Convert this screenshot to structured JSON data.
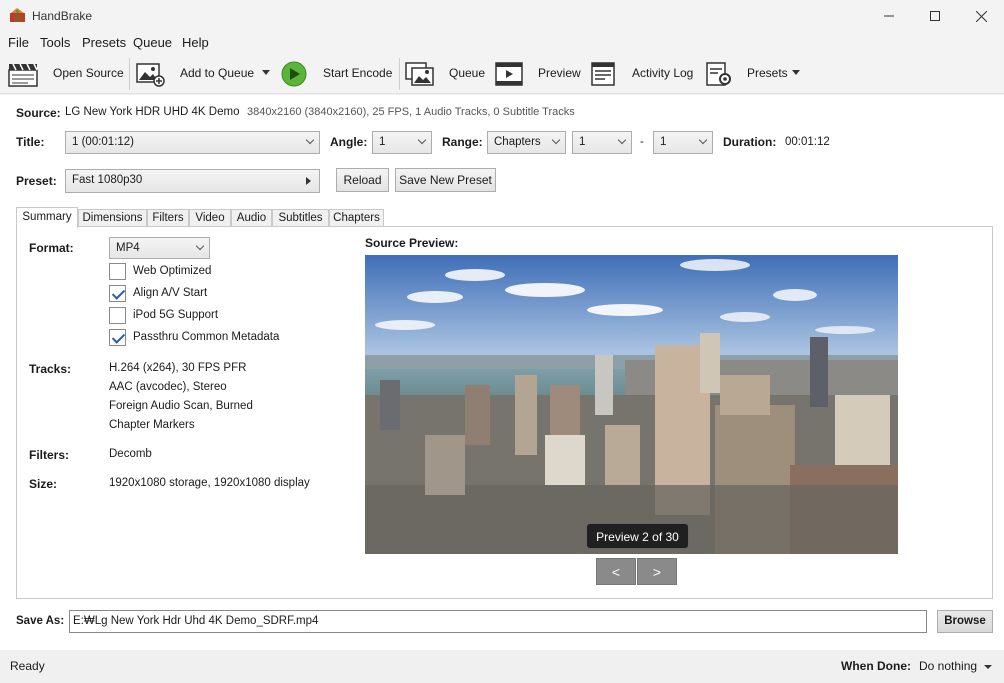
{
  "window": {
    "title": "HandBrake"
  },
  "menu": [
    "File",
    "Tools",
    "Presets",
    "Queue",
    "Help"
  ],
  "toolbar": {
    "open_source": "Open Source",
    "add_to_queue": "Add to Queue",
    "start_encode": "Start Encode",
    "queue": "Queue",
    "preview": "Preview",
    "activity_log": "Activity Log",
    "presets": "Presets"
  },
  "source": {
    "label": "Source:",
    "name": "LG New York HDR UHD 4K Demo",
    "details": "3840x2160 (3840x2160), 25 FPS, 1 Audio Tracks, 0 Subtitle Tracks"
  },
  "title_row": {
    "title_label": "Title:",
    "title_value": "1  (00:01:12)",
    "angle_label": "Angle:",
    "angle_value": "1",
    "range_label": "Range:",
    "range_mode": "Chapters",
    "range_start": "1",
    "range_dash": "-",
    "range_end": "1",
    "duration_label": "Duration:",
    "duration_value": "00:01:12"
  },
  "preset_row": {
    "label": "Preset:",
    "value": "Fast 1080p30",
    "reload": "Reload",
    "save_new": "Save New Preset"
  },
  "tabs": [
    "Summary",
    "Dimensions",
    "Filters",
    "Video",
    "Audio",
    "Subtitles",
    "Chapters"
  ],
  "summary": {
    "format_label": "Format:",
    "format_value": "MP4",
    "options": [
      {
        "label": "Web Optimized",
        "checked": false
      },
      {
        "label": "Align A/V Start",
        "checked": true
      },
      {
        "label": "iPod 5G Support",
        "checked": false
      },
      {
        "label": "Passthru Common Metadata",
        "checked": true
      }
    ],
    "tracks_label": "Tracks:",
    "tracks": [
      "H.264 (x264), 30 FPS PFR",
      "AAC (avcodec), Stereo",
      "Foreign Audio Scan, Burned",
      "Chapter Markers"
    ],
    "filters_label": "Filters:",
    "filters_value": "Decomb",
    "size_label": "Size:",
    "size_value": "1920x1080 storage, 1920x1080 display",
    "preview_label": "Source Preview:",
    "preview_badge": "Preview 2 of 30",
    "prev_btn": "<",
    "next_btn": ">"
  },
  "save_as": {
    "label": "Save As:",
    "value": "E:₩Lg New York Hdr Uhd 4K Demo_SDRF.mp4",
    "browse": "Browse"
  },
  "status": {
    "text": "Ready",
    "when_done_label": "When Done:",
    "when_done_value": "Do nothing"
  }
}
